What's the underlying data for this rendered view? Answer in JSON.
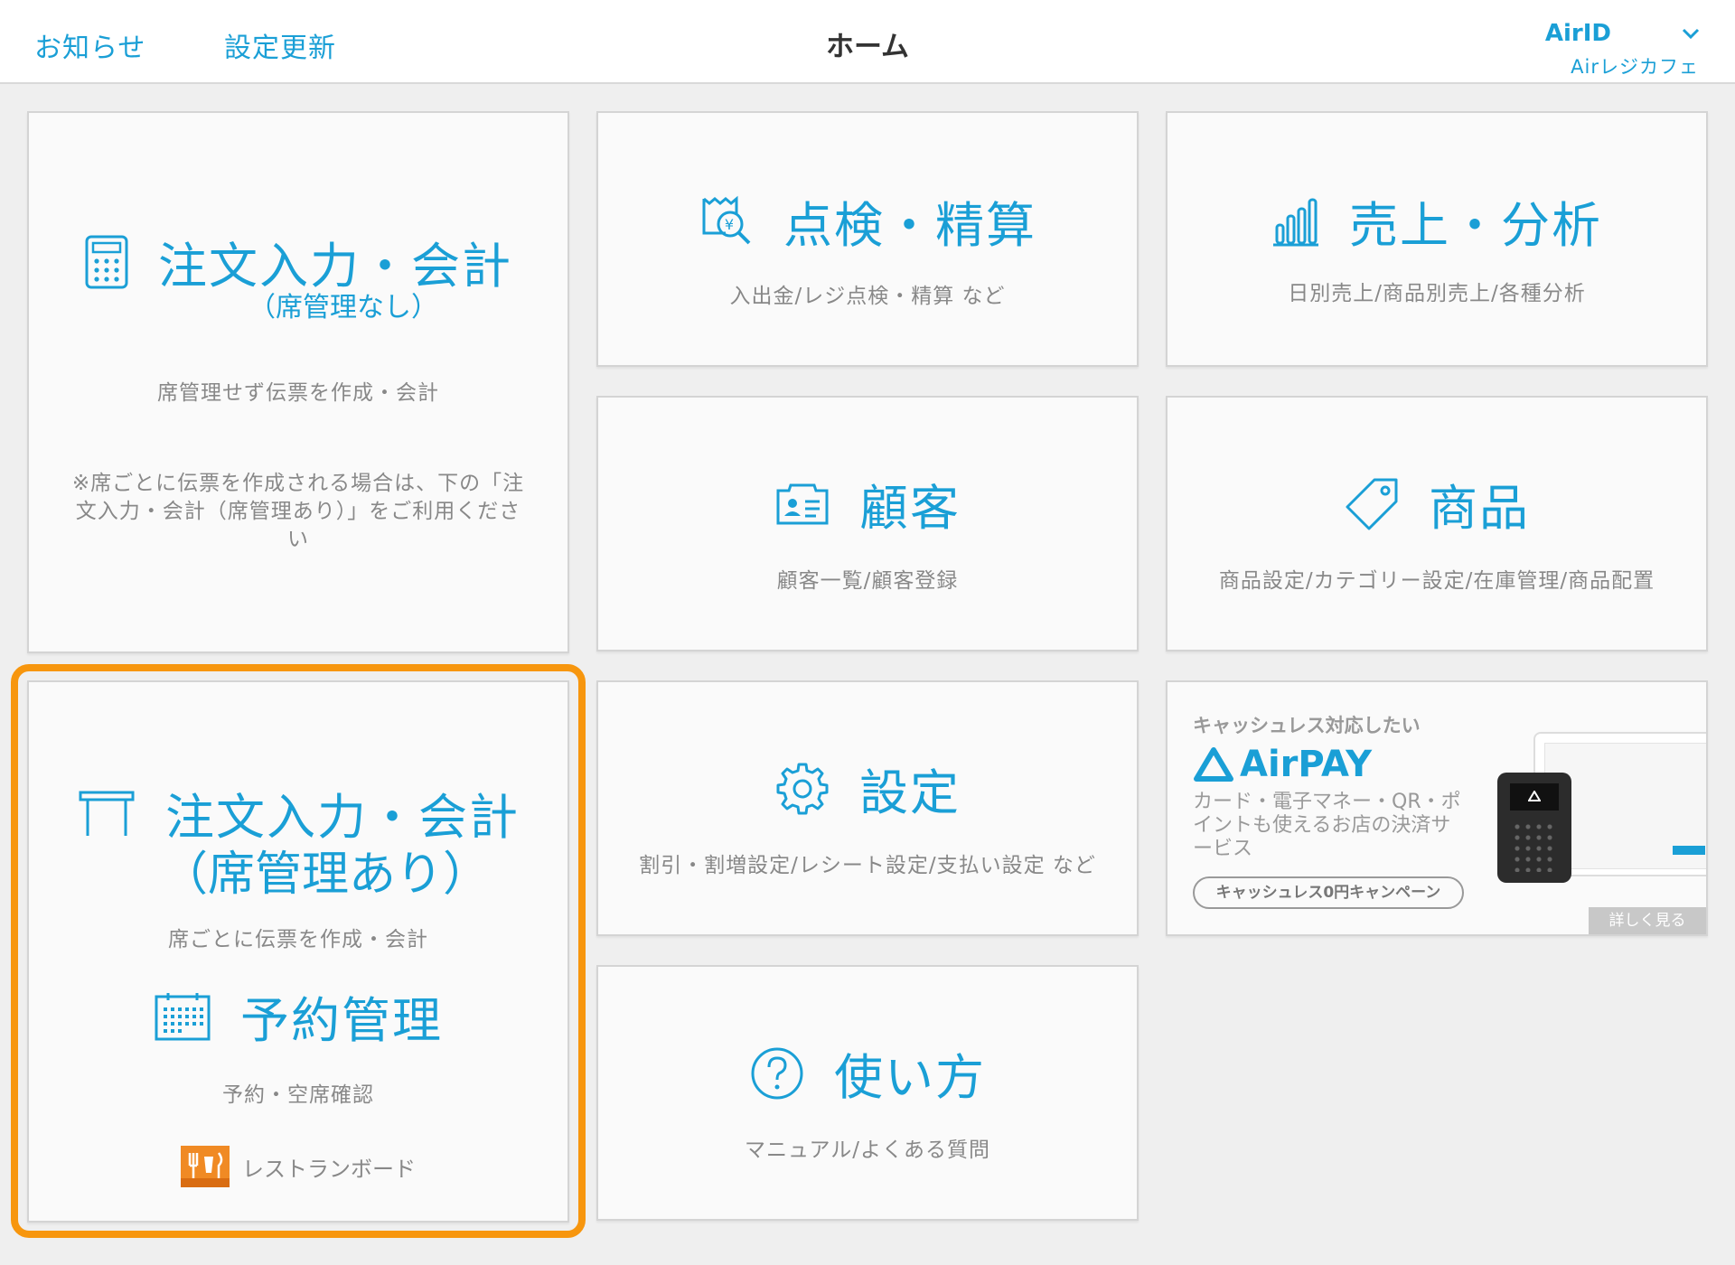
{
  "header": {
    "notice": "お知らせ",
    "settings_update": "設定更新",
    "title": "ホーム",
    "account_id": "AirID",
    "store_name": "Airレジカフェ"
  },
  "cards": {
    "order_no_seat": {
      "title": "注文入力・会計",
      "title_paren": "（席管理なし）",
      "desc": "席管理せず伝票を作成・会計",
      "note": "※席ごとに伝票を作成される場合は、下の「注文入力・会計（席管理あり）」をご利用ください"
    },
    "inspection": {
      "title": "点検・精算",
      "desc": "入出金/レジ点検・精算 など"
    },
    "sales": {
      "title": "売上・分析",
      "desc": "日別売上/商品別売上/各種分析"
    },
    "customer": {
      "title": "顧客",
      "desc": "顧客一覧/顧客登録"
    },
    "product": {
      "title": "商品",
      "desc": "商品設定/カテゴリー設定/在庫管理/商品配置"
    },
    "order_seat": {
      "title": "注文入力・会計",
      "title_paren": "（席管理あり）",
      "desc": "席ごとに伝票を作成・会計",
      "reserve_title": "予約管理",
      "reserve_desc": "予約・空席確認",
      "board_label": "レストランボード"
    },
    "settings": {
      "title": "設定",
      "desc": "割引・割増設定/レシート設定/支払い設定 など"
    },
    "promo": {
      "headline": "キャッシュレス対応したい",
      "brand": "AirPAY",
      "body": "カード・電子マネー・QR・ポイントも使えるお店の決済サービス",
      "campaign": "キャッシュレス0円キャンペーン",
      "more": "詳しく見る"
    },
    "howto": {
      "title": "使い方",
      "desc": "マニュアル/よくある質問"
    }
  },
  "colors": {
    "accent": "#1a9fd6",
    "highlight": "#f7960e"
  }
}
